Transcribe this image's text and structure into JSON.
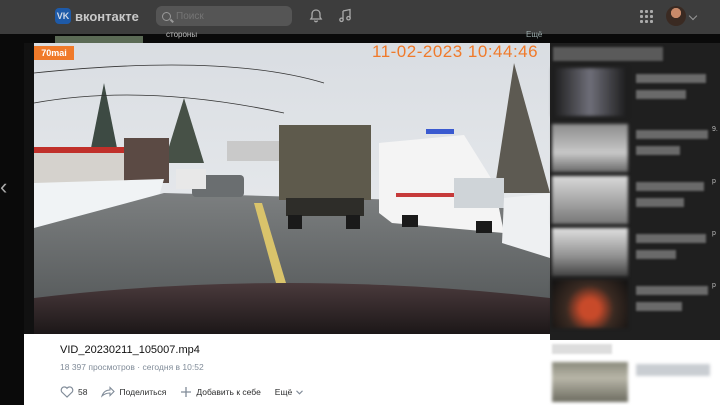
{
  "header": {
    "logo_badge": "VK",
    "logo_text": "вконтакте",
    "search_placeholder": "Поиск"
  },
  "behind": {
    "snippet_text": "стороны",
    "right_label": "Ещё"
  },
  "video": {
    "overlay_logo": "70mai",
    "timestamp": "11-02-2023 10:44:46"
  },
  "post": {
    "title": "VID_20230211_105007.mp4",
    "views": "18 397 просмотров",
    "date": "сегодня в 10:52",
    "likes": "58",
    "share_label": "Поделиться",
    "add_label": "Добавить к себе",
    "more_label": "Ещё"
  },
  "sidebar": {
    "row_labels": [
      "",
      "9.",
      "р",
      "р",
      "р"
    ]
  },
  "colors": {
    "accent": "#f07a2a",
    "vk_blue": "#1e5aa8"
  }
}
